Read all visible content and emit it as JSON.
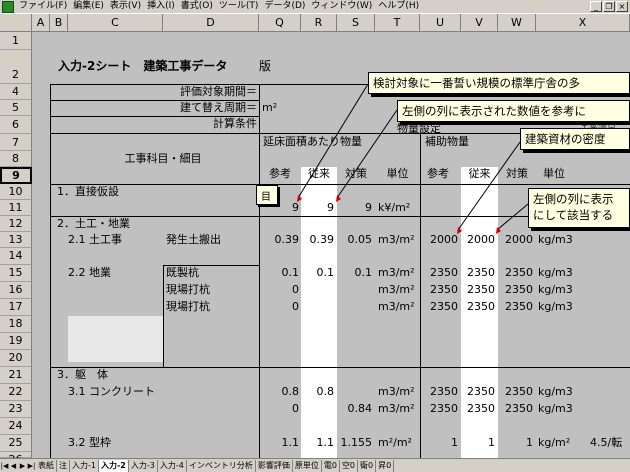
{
  "menu": {
    "items": [
      "ファイル(F)",
      "編集(E)",
      "表示(V)",
      "挿入(I)",
      "書式(O)",
      "ツール(T)",
      "データ(D)",
      "ウィンドウ(W)",
      "ヘルプ(H)"
    ]
  },
  "window_buttons": {
    "minimize": "_",
    "restore": "❐",
    "close": "×"
  },
  "columns": [
    "A",
    "B",
    "C",
    "D",
    "Q",
    "R",
    "S",
    "T",
    "U",
    "V",
    "W",
    "X"
  ],
  "rows": [
    "1",
    "2",
    "4",
    "5",
    "6",
    "7",
    "8",
    "9",
    "10",
    "11",
    "12",
    "13",
    "14",
    "15",
    "16",
    "17",
    "18",
    "19",
    "20",
    "21",
    "22",
    "23",
    "24",
    "25",
    "26"
  ],
  "sheet": {
    "title": "入力-2シート　建築工事データ",
    "title_suffix": "版",
    "eval_period_label": "評価対象期間＝",
    "rebuild_label": "建て替え周期＝",
    "m2_unit": "m²",
    "calc_label": "計算条件",
    "subtitle_partial": "物量設定",
    "x7_partial": "Ｉ番遠足",
    "work_item_label": "工事科目・細目",
    "header1": "延床面積あたり物量",
    "header2": "補助物量",
    "sub_headers": [
      "参考",
      "従来",
      "対策",
      "単位",
      "参考",
      "従来",
      "対策",
      "単位"
    ]
  },
  "body": [
    {
      "row": "10",
      "c": "1．直接仮設"
    },
    {
      "row": "11",
      "r": "9",
      "s": "9",
      "t": "k¥/m²",
      "q": "9"
    },
    {
      "row": "12",
      "c": "2．土工・地業"
    },
    {
      "row": "13",
      "c": "2.1 土工事",
      "d": "発生土搬出",
      "q": "0.39",
      "r": "0.39",
      "s": "0.05",
      "t": "m3/m²",
      "u": "2000",
      "v": "2000",
      "w": "2000",
      "x": "kg/m3"
    },
    {
      "row": "15",
      "c": "2.2 地業",
      "d": "既製杭",
      "q": "0.1",
      "r": "0.1",
      "s": "0.1",
      "t": "m3/m²",
      "u": "2350",
      "v": "2350",
      "w": "2350",
      "x": "kg/m3"
    },
    {
      "row": "16",
      "d": "現場打杭",
      "q": "0",
      "t": "m3/m²",
      "u": "2350",
      "v": "2350",
      "w": "2350",
      "x": "kg/m3"
    },
    {
      "row": "17",
      "d": "現場打杭",
      "q": "0",
      "t": "m3/m²",
      "u": "2350",
      "v": "2350",
      "w": "2350",
      "x": "kg/m3"
    },
    {
      "row": "21",
      "c": "3．躯　体"
    },
    {
      "row": "22",
      "c": "3.1 コンクリート",
      "q": "0.8",
      "r": "0.8",
      "t": "m3/m²",
      "u": "2350",
      "v": "2350",
      "w": "2350",
      "x": "kg/m3"
    },
    {
      "row": "23",
      "q": "0",
      "s": "0.84",
      "t": "m3/m²",
      "u": "2350",
      "v": "2350",
      "w": "2350",
      "x": "kg/m3"
    },
    {
      "row": "25",
      "c": "3.2 型枠",
      "q": "1.1",
      "r": "1.1",
      "s": "1.155",
      "t": "m²/m²",
      "u": "1",
      "v": "1",
      "w": "1",
      "x": "kg/m²",
      "extra": "4.5/転"
    }
  ],
  "comments": [
    "検討対象に一番誓い規模の標準庁舎の多",
    "左側の列に表示された数値を参考に",
    "建築資材の密度",
    "左側の列に表示",
    "にして該当する",
    "目"
  ],
  "tabs": [
    "表紙",
    "注",
    "入力-1",
    "入力-2",
    "入力-3",
    "入力-4",
    "インベントリ分析",
    "影響評価",
    "原単位",
    "電0",
    "空0",
    "衛0",
    "昇0"
  ],
  "active_tab": "入力-2",
  "tab_nav": [
    "|◀",
    "◀",
    "▶",
    "▶|"
  ]
}
